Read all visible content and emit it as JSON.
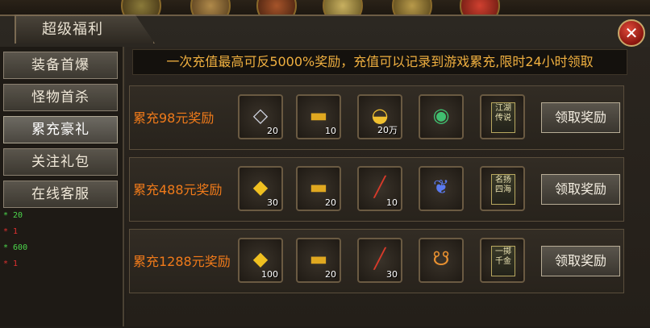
{
  "window": {
    "title": "超级福利",
    "close_symbol": "✕"
  },
  "colors": {
    "accent_orange": "#f07a1a",
    "banner_text": "#f0b040",
    "log_green": "#4cd64c",
    "log_red": "#e03030"
  },
  "sidebar": {
    "items": [
      {
        "label": "装备首爆",
        "active": false
      },
      {
        "label": "怪物首杀",
        "active": false
      },
      {
        "label": "累充豪礼",
        "active": true
      },
      {
        "label": "关注礼包",
        "active": false
      },
      {
        "label": "在线客服",
        "active": false
      }
    ],
    "log": [
      {
        "text": "* 20",
        "color": "green"
      },
      {
        "text": "* 1",
        "color": "red"
      },
      {
        "text": "* 600",
        "color": "green"
      },
      {
        "text": "* 1",
        "color": "red"
      }
    ]
  },
  "banner": "一次充值最高可反5000%奖励，充值可以记录到游戏累充,限时24小时领取",
  "rewards": [
    {
      "label": "累充98元奖励",
      "claim_label": "领取奖励",
      "items": [
        {
          "icon": "silver-ticket-icon",
          "glyph": "🎫",
          "count": "20"
        },
        {
          "icon": "gold-bar-icon",
          "glyph": "▬",
          "count": "10"
        },
        {
          "icon": "gold-ingot-icon",
          "glyph": "◒",
          "count": "20万"
        },
        {
          "icon": "jade-amulet-icon",
          "glyph": "◉",
          "count": ""
        },
        {
          "icon": "title-plaque-icon",
          "plaque": "江湖传说",
          "count": ""
        }
      ]
    },
    {
      "label": "累充488元奖励",
      "claim_label": "领取奖励",
      "items": [
        {
          "icon": "gold-ticket-icon",
          "glyph": "◆",
          "count": "30"
        },
        {
          "icon": "gold-bar-icon",
          "glyph": "▬",
          "count": "20"
        },
        {
          "icon": "scroll-icon",
          "glyph": "╱",
          "count": "10"
        },
        {
          "icon": "blue-dragon-icon",
          "glyph": "❦",
          "count": ""
        },
        {
          "icon": "title-plaque-icon",
          "plaque": "名扬四海",
          "count": ""
        }
      ]
    },
    {
      "label": "累充1288元奖励",
      "claim_label": "领取奖励",
      "items": [
        {
          "icon": "gold-ticket-icon",
          "glyph": "◆",
          "count": "100"
        },
        {
          "icon": "gold-bar-icon",
          "glyph": "▬",
          "count": "20"
        },
        {
          "icon": "scroll-icon",
          "glyph": "╱",
          "count": "30"
        },
        {
          "icon": "gourd-icon",
          "glyph": "☋",
          "count": ""
        },
        {
          "icon": "title-plaque-icon",
          "plaque": "一掷千金",
          "count": ""
        }
      ]
    }
  ]
}
